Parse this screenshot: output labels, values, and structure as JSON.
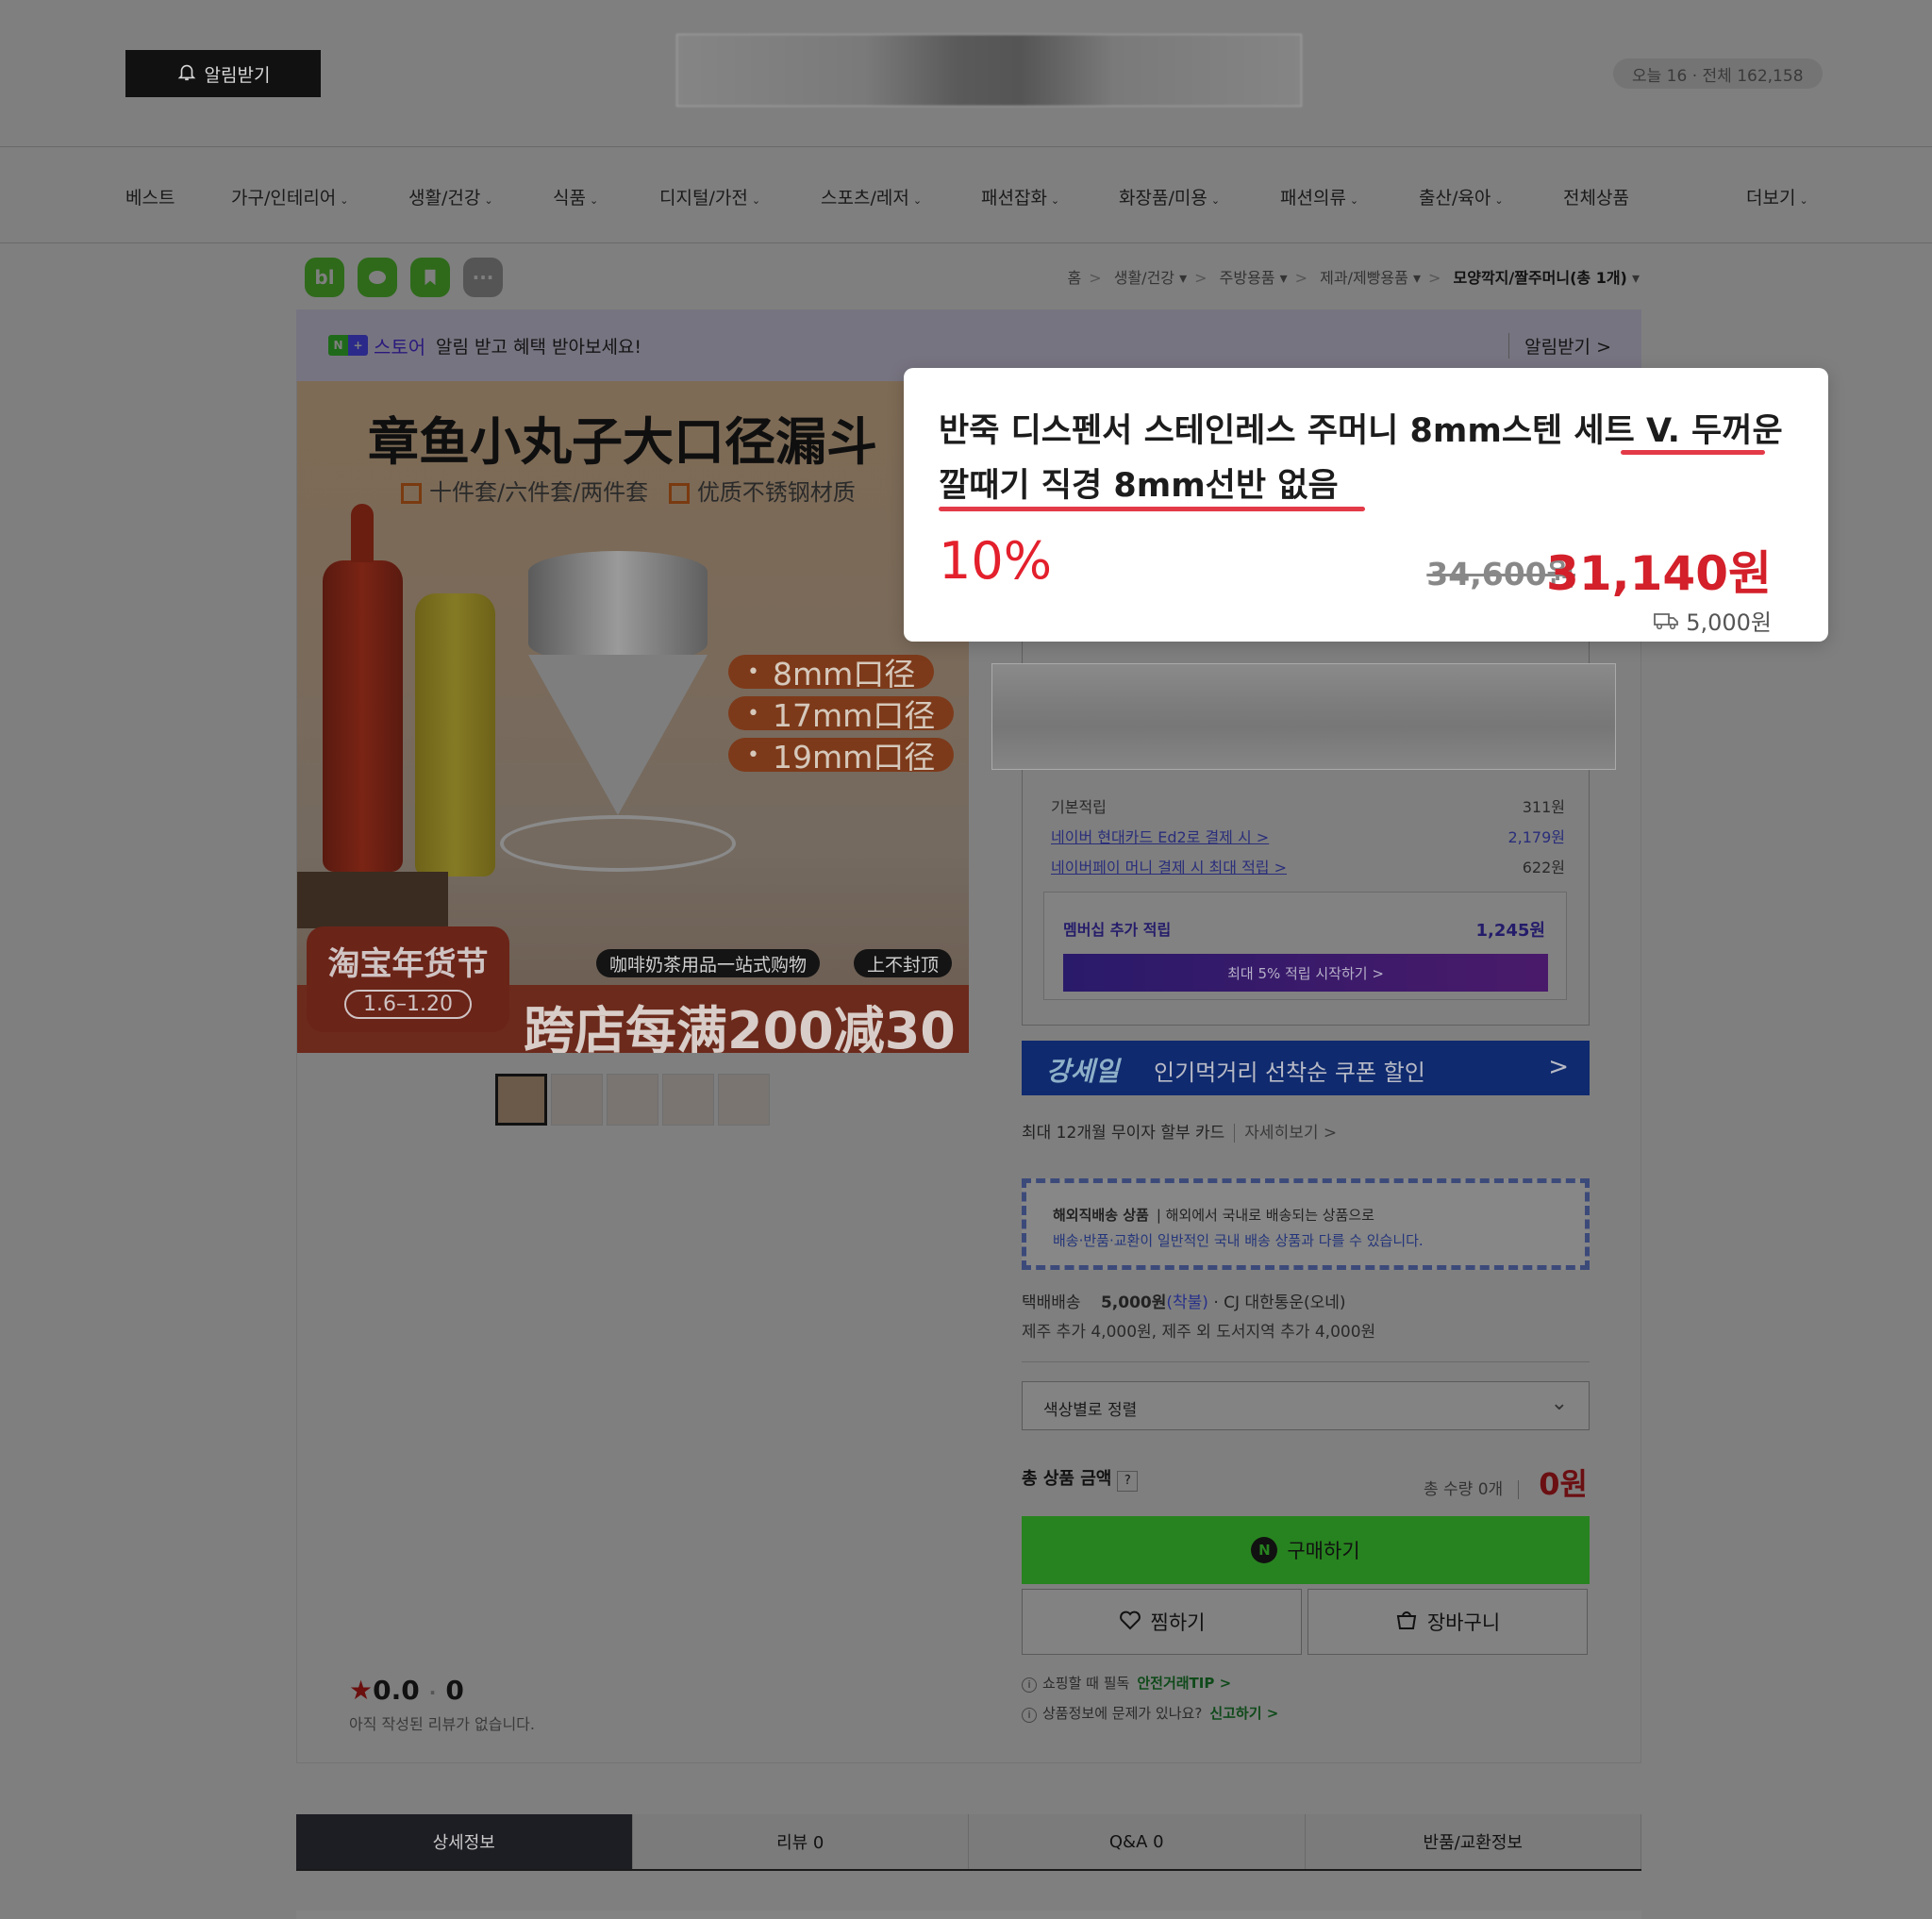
{
  "header": {
    "notify_label": "알림받기",
    "visitor": "오늘 16 · 전체 162,158"
  },
  "nav": {
    "items": [
      "베스트",
      "가구/인테리어",
      "생활/건강",
      "식품",
      "디지털/가전",
      "스포츠/레저",
      "패션잡화",
      "화장품/미용",
      "패션의류",
      "출산/육아",
      "전체상품",
      "더보기"
    ]
  },
  "quick_icons": [
    "bl",
    "",
    "",
    "···"
  ],
  "breadcrumb": [
    "홈",
    "생활/건강",
    "주방용품",
    "제과/제빵용품",
    "모양깍지/짤주머니(총 1개)"
  ],
  "alert_bar": {
    "badge": "N+",
    "store": "스토어",
    "message": "알림 받고 혜택 받아보세요!",
    "action": "알림받기 >"
  },
  "product_image": {
    "title": "章鱼小丸子大口径漏斗",
    "subtitle_1": "十件套/六件套/两件套",
    "subtitle_2": "优质不锈钢材质",
    "pills": [
      "8mm口径",
      "17mm口径",
      "19mm口径"
    ],
    "badge_1": "咖啡奶茶用品一站式购物",
    "badge_2": "上不封顶",
    "promo_title": "淘宝年货节",
    "promo_dates": "1.6–1.20",
    "promo_big": "跨店每满200减30"
  },
  "rating": {
    "score": "0.0",
    "count": "0",
    "empty_text": "아직 작성된 리뷰가 없습니다."
  },
  "card": {
    "title": "반죽 디스펜서 스테인레스 주머니 8mm스텐 세트 V. 두꺼운 깔때기 직경 8mm선반 없음",
    "discount": "10%",
    "original_price": "34,600원",
    "sale_price": "31,140원",
    "shipping": "5,000원"
  },
  "benefits": {
    "rows": [
      {
        "label": "기본적립",
        "value": "311원"
      },
      {
        "label": "네이버 현대카드 Ed2로 결제 시 >",
        "value": "2,179원"
      },
      {
        "label": "네이버페이 머니 결제 시 최대 적립 >",
        "value": "622원"
      }
    ],
    "membership_label": "멤버십 추가 적립",
    "membership_value": "1,245원",
    "membership_cta": "최대 5% 적립 시작하기 >"
  },
  "banner": {
    "brand": "강세일",
    "text": "인기먹거리 선착순 쿠폰 할인",
    "arrow": ">"
  },
  "installment": {
    "text": "최대 12개월 무이자 할부 카드",
    "link": "자세히보기 >"
  },
  "intl": {
    "title": "해외직배송 상품",
    "desc": "해외에서 국내로 배송되는 상품으로",
    "note": "배송·반품·교환이 일반적인 국내 배송 상품과 다를 수 있습니다."
  },
  "delivery": {
    "type": "택배배송",
    "fee": "5,000원",
    "cod": "(착불)",
    "carrier": "· CJ 대한통운(오네)",
    "extra": "제주 추가 4,000원, 제주 외 도서지역 추가 4,000원"
  },
  "option_select": {
    "label": "색상별로 정렬"
  },
  "total": {
    "label": "총 상품 금액",
    "help": "?",
    "count": "총 수량 0개",
    "amount": "0원"
  },
  "actions": {
    "buy": "구매하기",
    "wish": "찜하기",
    "cart": "장바구니"
  },
  "tips": [
    {
      "text": "쇼핑할 때 필독",
      "link": "안전거래TIP >"
    },
    {
      "text": "상품정보에 문제가 있나요?",
      "link": "신고하기 >"
    }
  ],
  "tabs": [
    "상세정보",
    "리뷰 0",
    "Q&A 0",
    "반품/교환정보"
  ]
}
